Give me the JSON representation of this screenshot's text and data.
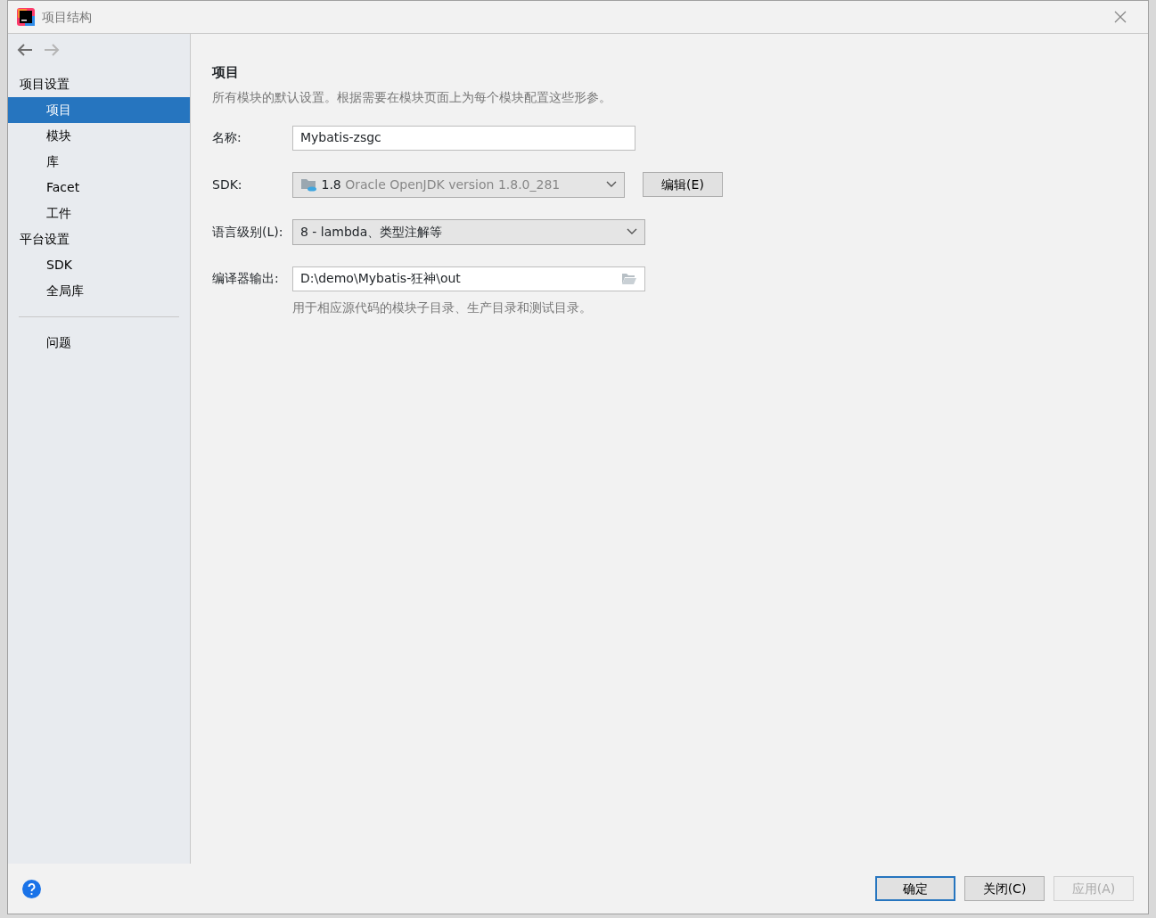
{
  "window": {
    "title": "项目结构"
  },
  "nav": {
    "back_disabled": false,
    "forward_disabled": true
  },
  "sidebar": {
    "groups": [
      {
        "header": "项目设置",
        "items": [
          {
            "label": "项目",
            "selected": true
          },
          {
            "label": "模块",
            "selected": false
          },
          {
            "label": "库",
            "selected": false
          },
          {
            "label": "Facet",
            "selected": false
          },
          {
            "label": "工件",
            "selected": false
          }
        ]
      },
      {
        "header": "平台设置",
        "items": [
          {
            "label": "SDK",
            "selected": false
          },
          {
            "label": "全局库",
            "selected": false
          }
        ]
      }
    ],
    "bottom_items": [
      {
        "label": "问题",
        "selected": false
      }
    ]
  },
  "content": {
    "title": "项目",
    "description": "所有模块的默认设置。根据需要在模块页面上为每个模块配置这些形参。",
    "fields": [
      {
        "kind": "text",
        "label": "名称:",
        "value": "Mybatis-zsgc"
      },
      {
        "kind": "sdk",
        "label": "SDK:",
        "version": "1.8",
        "detail": "Oracle OpenJDK version 1.8.0_281",
        "button": "编辑(E)"
      },
      {
        "kind": "select",
        "label": "语言级别(L):",
        "value": "8 - lambda、类型注解等"
      },
      {
        "kind": "path",
        "label": "编译器输出:",
        "value": "D:\\demo\\Mybatis-狂神\\out",
        "hint": "用于相应源代码的模块子目录、生产目录和测试目录。"
      }
    ]
  },
  "footer": {
    "buttons": [
      {
        "label": "确定",
        "primary": true,
        "disabled": false
      },
      {
        "label": "关闭(C)",
        "primary": false,
        "disabled": false
      },
      {
        "label": "应用(A)",
        "primary": false,
        "disabled": true
      }
    ]
  }
}
